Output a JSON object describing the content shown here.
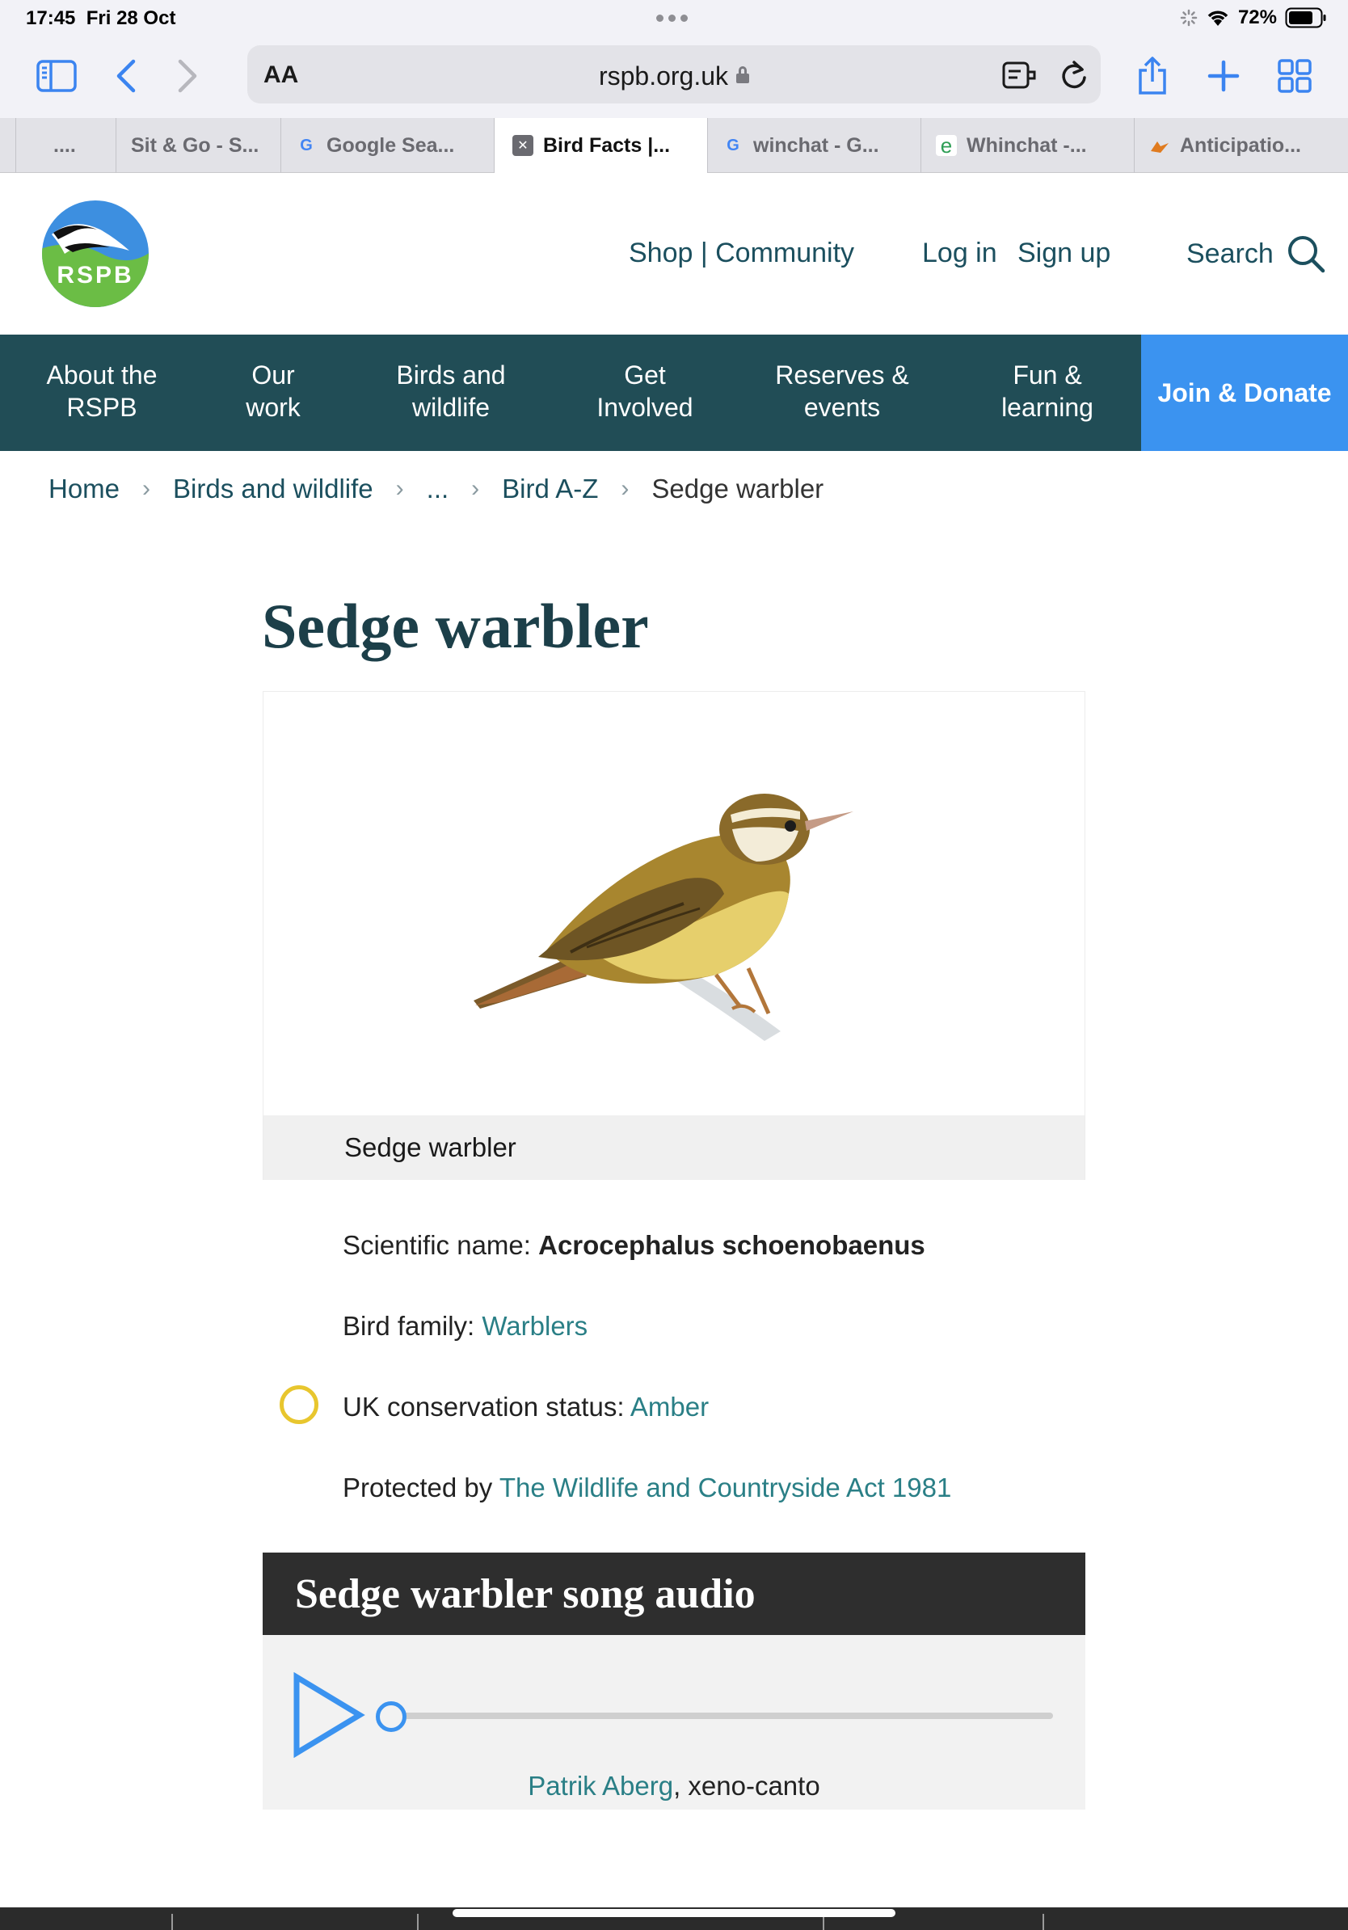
{
  "status_bar": {
    "time": "17:45",
    "date": "Fri 28 Oct",
    "battery_pct": "72%"
  },
  "toolbar": {
    "icons": [
      "sidebar-icon",
      "back-icon",
      "forward-icon",
      "share-icon",
      "new-tab-icon",
      "tab-overview-icon"
    ],
    "aa_label": "AA",
    "url": "rspb.org.uk",
    "url_icons": [
      "reader-icon",
      "reload-icon"
    ]
  },
  "tabs": [
    {
      "label": "....",
      "favicon": ""
    },
    {
      "label": "Sit & Go - S...",
      "favicon": ""
    },
    {
      "label": "Google Sea...",
      "favicon": "G"
    },
    {
      "label": "Bird Facts |...",
      "favicon": "✕"
    },
    {
      "label": "winchat - G...",
      "favicon": "G"
    },
    {
      "label": "Whinchat -...",
      "favicon": "e"
    },
    {
      "label": "Anticipatio...",
      "favicon": ""
    }
  ],
  "header": {
    "logo_text": "RSPB",
    "shop_community": "Shop | Community",
    "log_in": "Log in",
    "sign_up": "Sign up",
    "search": "Search"
  },
  "nav": {
    "items": [
      {
        "line1": "About the",
        "line2": "RSPB"
      },
      {
        "line1": "Our",
        "line2": "work"
      },
      {
        "line1": "Birds and",
        "line2": "wildlife"
      },
      {
        "line1": "Get",
        "line2": "Involved"
      },
      {
        "line1": "Reserves &",
        "line2": "events"
      },
      {
        "line1": "Fun &",
        "line2": "learning"
      }
    ],
    "join": "Join & Donate"
  },
  "breadcrumb": {
    "items": [
      "Home",
      "Birds and wildlife",
      "...",
      "Bird A-Z"
    ],
    "current": "Sedge warbler"
  },
  "page": {
    "title": "Sedge warbler",
    "image_caption": "Sedge warbler",
    "scientific_label": "Scientific name: ",
    "scientific_name": "Acrocephalus schoenobaenus",
    "family_label": "Bird family: ",
    "family": "Warblers",
    "status_label": "UK conservation status: ",
    "status": "Amber",
    "protected_label": "Protected by ",
    "protected_by": "The Wildlife and Countryside Act 1981"
  },
  "audio": {
    "heading": "Sedge warbler song audio",
    "progress": 0,
    "credit_author": "Patrik Aberg",
    "credit_source": ", xeno-canto"
  },
  "colors": {
    "nav_bg": "#214d56",
    "join_bg": "#3b93f0",
    "link": "#2a7f86",
    "header_link": "#1b4f5e",
    "amber": "#e8c62e",
    "safari_blue": "#3b84f0"
  }
}
